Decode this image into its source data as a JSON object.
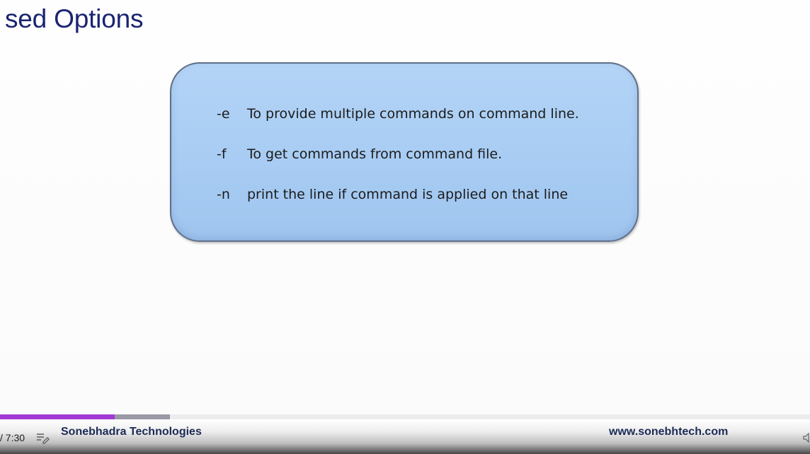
{
  "slide": {
    "title": "sed Options",
    "options": [
      {
        "flag": "-e",
        "description": "To provide multiple commands on command line."
      },
      {
        "flag": "-f",
        "description": "To get commands from command file."
      },
      {
        "flag": "-n",
        "description": "print the line if command is applied on that line"
      }
    ]
  },
  "player": {
    "time": "/ 7:30",
    "played_fraction": 0.142,
    "buffered_fraction": 0.21,
    "played_color": "#a239d6",
    "transcript_icon": "transcript-icon",
    "volume_icon": "volume-icon"
  },
  "footer": {
    "brand": "Sonebhadra Technologies",
    "website": "www.sonebhtech.com"
  }
}
